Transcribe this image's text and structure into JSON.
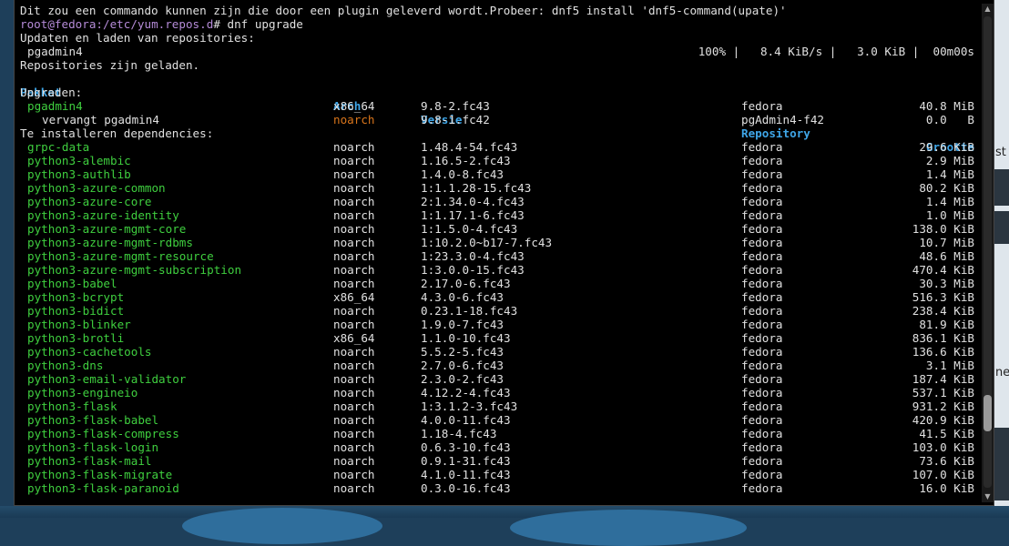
{
  "terminal": {
    "notice": "Dit zou een commando kunnen zijn die door een plugin geleverd wordt.Probeer: dnf5 install 'dnf5-command(upate)'",
    "prompt": {
      "user_host": "root@fedora",
      "path": ":/etc/yum.repos.d",
      "symbol": "#",
      "command": " dnf upgrade"
    },
    "updating": "Updaten en laden van repositories:",
    "progress": {
      "name": "pgadmin4",
      "stats": "100% |   8.4 KiB/s |   3.0 KiB |  00m00s"
    },
    "loaded": "Repositories zijn geladen.",
    "headers": {
      "package": "Pakket",
      "arch": "Arch",
      "version": "Versie",
      "repository": "Repository",
      "size": "Grootte"
    },
    "section_upgrade": "Upgraden:",
    "upgrade_rows": [
      {
        "package": "pgadmin4",
        "arch": "x86_64",
        "version": "9.8-2.fc43",
        "repository": "fedora",
        "size": "40.8 MiB"
      },
      {
        "package": "vervangt pgadmin4",
        "arch": "noarch",
        "version": "9.8-1.fc42",
        "repository": "pgAdmin4-f42",
        "size": "0.0   B"
      }
    ],
    "section_deps": "Te installeren dependencies:",
    "dep_rows": [
      {
        "package": "grpc-data",
        "arch": "noarch",
        "version": "1.48.4-54.fc43",
        "repository": "fedora",
        "size": "29.6 KiB"
      },
      {
        "package": "python3-alembic",
        "arch": "noarch",
        "version": "1.16.5-2.fc43",
        "repository": "fedora",
        "size": "2.9 MiB"
      },
      {
        "package": "python3-authlib",
        "arch": "noarch",
        "version": "1.4.0-8.fc43",
        "repository": "fedora",
        "size": "1.4 MiB"
      },
      {
        "package": "python3-azure-common",
        "arch": "noarch",
        "version": "1:1.1.28-15.fc43",
        "repository": "fedora",
        "size": "80.2 KiB"
      },
      {
        "package": "python3-azure-core",
        "arch": "noarch",
        "version": "2:1.34.0-4.fc43",
        "repository": "fedora",
        "size": "1.4 MiB"
      },
      {
        "package": "python3-azure-identity",
        "arch": "noarch",
        "version": "1:1.17.1-6.fc43",
        "repository": "fedora",
        "size": "1.0 MiB"
      },
      {
        "package": "python3-azure-mgmt-core",
        "arch": "noarch",
        "version": "1:1.5.0-4.fc43",
        "repository": "fedora",
        "size": "138.0 KiB"
      },
      {
        "package": "python3-azure-mgmt-rdbms",
        "arch": "noarch",
        "version": "1:10.2.0~b17-7.fc43",
        "repository": "fedora",
        "size": "10.7 MiB"
      },
      {
        "package": "python3-azure-mgmt-resource",
        "arch": "noarch",
        "version": "1:23.3.0-4.fc43",
        "repository": "fedora",
        "size": "48.6 MiB"
      },
      {
        "package": "python3-azure-mgmt-subscription",
        "arch": "noarch",
        "version": "1:3.0.0-15.fc43",
        "repository": "fedora",
        "size": "470.4 KiB"
      },
      {
        "package": "python3-babel",
        "arch": "noarch",
        "version": "2.17.0-6.fc43",
        "repository": "fedora",
        "size": "30.3 MiB"
      },
      {
        "package": "python3-bcrypt",
        "arch": "x86_64",
        "version": "4.3.0-6.fc43",
        "repository": "fedora",
        "size": "516.3 KiB"
      },
      {
        "package": "python3-bidict",
        "arch": "noarch",
        "version": "0.23.1-18.fc43",
        "repository": "fedora",
        "size": "238.4 KiB"
      },
      {
        "package": "python3-blinker",
        "arch": "noarch",
        "version": "1.9.0-7.fc43",
        "repository": "fedora",
        "size": "81.9 KiB"
      },
      {
        "package": "python3-brotli",
        "arch": "x86_64",
        "version": "1.1.0-10.fc43",
        "repository": "fedora",
        "size": "836.1 KiB"
      },
      {
        "package": "python3-cachetools",
        "arch": "noarch",
        "version": "5.5.2-5.fc43",
        "repository": "fedora",
        "size": "136.6 KiB"
      },
      {
        "package": "python3-dns",
        "arch": "noarch",
        "version": "2.7.0-6.fc43",
        "repository": "fedora",
        "size": "3.1 MiB"
      },
      {
        "package": "python3-email-validator",
        "arch": "noarch",
        "version": "2.3.0-2.fc43",
        "repository": "fedora",
        "size": "187.4 KiB"
      },
      {
        "package": "python3-engineio",
        "arch": "noarch",
        "version": "4.12.2-4.fc43",
        "repository": "fedora",
        "size": "537.1 KiB"
      },
      {
        "package": "python3-flask",
        "arch": "noarch",
        "version": "1:3.1.2-3.fc43",
        "repository": "fedora",
        "size": "931.2 KiB"
      },
      {
        "package": "python3-flask-babel",
        "arch": "noarch",
        "version": "4.0.0-11.fc43",
        "repository": "fedora",
        "size": "420.9 KiB"
      },
      {
        "package": "python3-flask-compress",
        "arch": "noarch",
        "version": "1.18-4.fc43",
        "repository": "fedora",
        "size": "41.5 KiB"
      },
      {
        "package": "python3-flask-login",
        "arch": "noarch",
        "version": "0.6.3-10.fc43",
        "repository": "fedora",
        "size": "103.0 KiB"
      },
      {
        "package": "python3-flask-mail",
        "arch": "noarch",
        "version": "0.9.1-31.fc43",
        "repository": "fedora",
        "size": "73.6 KiB"
      },
      {
        "package": "python3-flask-migrate",
        "arch": "noarch",
        "version": "4.1.0-11.fc43",
        "repository": "fedora",
        "size": "107.0 KiB"
      },
      {
        "package": "python3-flask-paranoid",
        "arch": "noarch",
        "version": "0.3.0-16.fc43",
        "repository": "fedora",
        "size": "16.0 KiB"
      }
    ]
  },
  "scrollbar": {
    "up_icon": "triangle-up",
    "down_icon": "triangle-down",
    "position_fraction": 0.87
  },
  "desktop": {
    "right_text_top": "st",
    "right_text_mid": "ne",
    "accent_color": "#3fcf3f",
    "header_color": "#3fa6e8",
    "prompt_color": "#b58bd8"
  }
}
